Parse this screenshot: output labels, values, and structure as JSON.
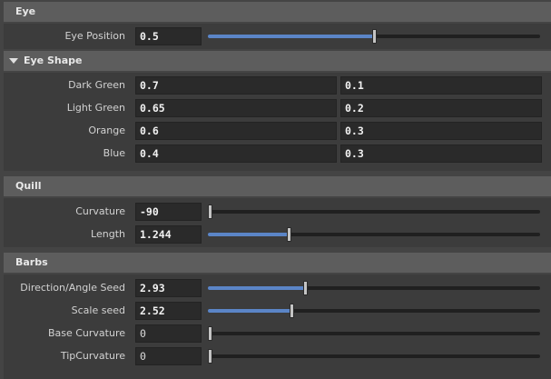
{
  "sections": {
    "eye": "Eye",
    "eye_shape": "Eye Shape",
    "quill": "Quill",
    "barbs": "Barbs"
  },
  "eye": {
    "position": {
      "label": "Eye Position",
      "value": "0.5",
      "slider": 0.5
    }
  },
  "eye_shape": {
    "rows": [
      {
        "label": "Dark Green",
        "a": "0.7",
        "b": "0.1"
      },
      {
        "label": "Light Green",
        "a": "0.65",
        "b": "0.2"
      },
      {
        "label": "Orange",
        "a": "0.6",
        "b": "0.3"
      },
      {
        "label": "Blue",
        "a": "0.4",
        "b": "0.3"
      }
    ]
  },
  "quill": {
    "curvature": {
      "label": "Curvature",
      "value": "-90",
      "slider": 0.0
    },
    "length": {
      "label": "Length",
      "value": "1.244",
      "slider": 0.24
    }
  },
  "barbs": {
    "direction_seed": {
      "label": "Direction/Angle Seed",
      "value": "2.93",
      "slider": 0.29
    },
    "scale_seed": {
      "label": "Scale seed",
      "value": "2.52",
      "slider": 0.25
    },
    "base_curvature": {
      "label": "Base Curvature",
      "value": "0",
      "slider": 0.0
    },
    "tip_curvature": {
      "label": "TipCurvature",
      "value": "0",
      "slider": 0.0
    }
  },
  "colors": {
    "accent": "#5b85c7",
    "header": "#5d5d5d",
    "panel": "#3c3c3c"
  }
}
